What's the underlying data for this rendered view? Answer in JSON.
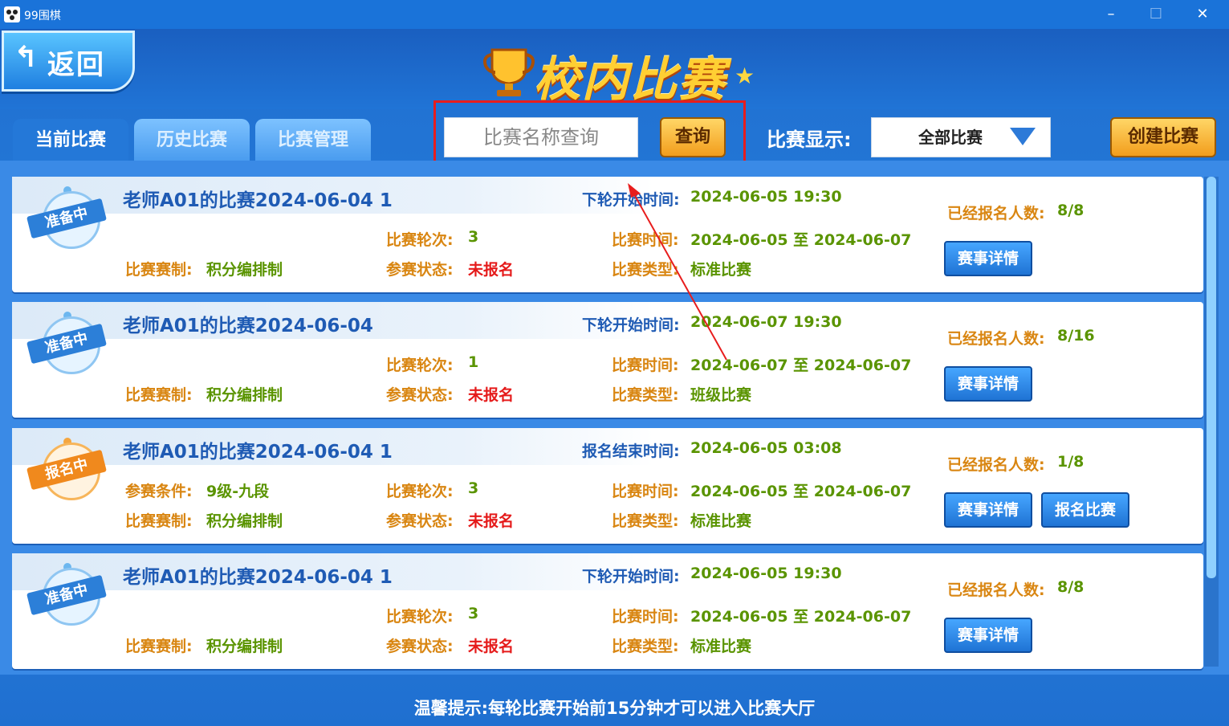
{
  "window": {
    "title": "99围棋"
  },
  "header": {
    "back_label": "返回",
    "logo_text": "校内比赛"
  },
  "tabs": [
    {
      "label": "当前比赛"
    },
    {
      "label": "历史比赛"
    },
    {
      "label": "比赛管理"
    }
  ],
  "search": {
    "placeholder": "比赛名称查询",
    "button": "查询"
  },
  "filter": {
    "label": "比赛显示:",
    "value": "全部比赛"
  },
  "create_label": "创建比赛",
  "labels": {
    "rounds": "比赛轮次:",
    "system": "比赛赛制:",
    "status": "参赛状态:",
    "time": "比赛时间:",
    "type": "比赛类型:",
    "registered": "已经报名人数:",
    "condition": "参赛条件:",
    "detail_btn": "赛事详情",
    "register_btn": "报名比赛"
  },
  "matches": [
    {
      "badge": "准备中",
      "name": "老师A01的比赛2024-06-04 1",
      "time_label": "下轮开始时间:",
      "time_value": "2024-06-05 19:30",
      "rounds": "3",
      "system": "积分编排制",
      "status": "未报名",
      "range": "2024-06-05 至 2024-06-07",
      "type": "标准比赛",
      "registered": "8/8"
    },
    {
      "badge": "准备中",
      "name": "老师A01的比赛2024-06-04",
      "time_label": "下轮开始时间:",
      "time_value": "2024-06-07 19:30",
      "rounds": "1",
      "system": "积分编排制",
      "status": "未报名",
      "range": "2024-06-07 至 2024-06-07",
      "type": "班级比赛",
      "registered": "8/16"
    },
    {
      "badge": "报名中",
      "name": "老师A01的比赛2024-06-04 1",
      "time_label": "报名结束时间:",
      "time_value": "2024-06-05 03:08",
      "condition": "9级-九段",
      "rounds": "3",
      "system": "积分编排制",
      "status": "未报名",
      "range": "2024-06-05 至 2024-06-07",
      "type": "标准比赛",
      "registered": "1/8"
    },
    {
      "badge": "准备中",
      "name": "老师A01的比赛2024-06-04 1",
      "time_label": "下轮开始时间:",
      "time_value": "2024-06-05 19:30",
      "rounds": "3",
      "system": "积分编排制",
      "status": "未报名",
      "range": "2024-06-05 至 2024-06-07",
      "type": "标准比赛",
      "registered": "8/8"
    }
  ],
  "tip": "温馨提示:每轮比赛开始前15分钟才可以进入比赛大厅",
  "colors": {
    "accent": "#2478d8",
    "annotation": "#e81d1d"
  },
  "icons": [
    "app-icon",
    "back-arrow-icon",
    "trophy-icon",
    "star-icon",
    "dropdown-triangle-icon"
  ]
}
